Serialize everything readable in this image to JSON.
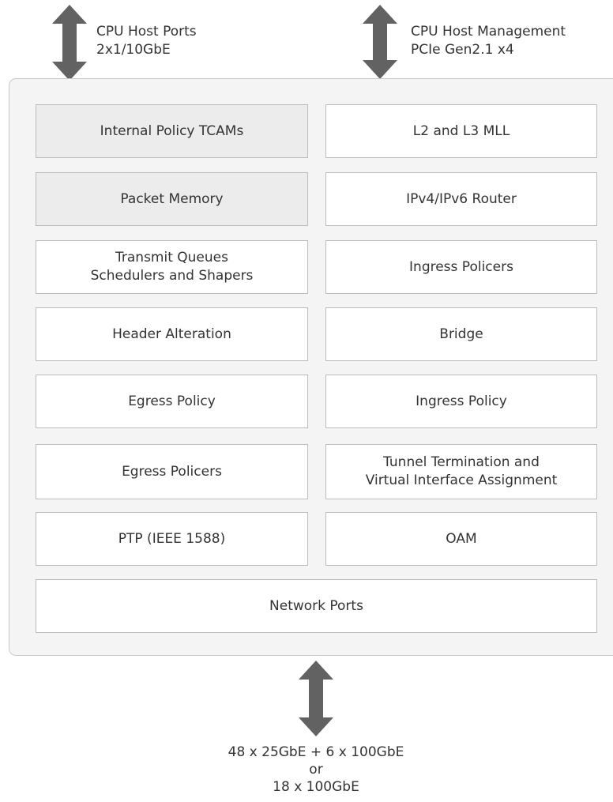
{
  "colors": {
    "arrow": "#626262",
    "chip_bg": "#f4f4f4",
    "chip_border": "#c9c9c9",
    "block_bg": "#ffffff",
    "block_shaded_bg": "#ececec",
    "block_border": "#bcbcbc",
    "text": "#333333"
  },
  "top": {
    "left_label": [
      "CPU Host Ports",
      "2x1/10GbE"
    ],
    "right_label": [
      "CPU Host Management",
      "PCIe Gen2.1 x4"
    ]
  },
  "left_column": [
    {
      "lines": [
        "Internal Policy TCAMs"
      ],
      "shaded": true
    },
    {
      "lines": [
        "Packet Memory"
      ],
      "shaded": true
    },
    {
      "lines": [
        "Transmit Queues",
        "Schedulers and Shapers"
      ],
      "shaded": false
    },
    {
      "lines": [
        "Header Alteration"
      ],
      "shaded": false
    },
    {
      "lines": [
        "Egress Policy"
      ],
      "shaded": false
    },
    {
      "lines": [
        "Egress Policers"
      ],
      "shaded": false
    },
    {
      "lines": [
        "PTP (IEEE 1588)"
      ],
      "shaded": false
    }
  ],
  "right_column": [
    {
      "lines": [
        "L2 and L3 MLL"
      ],
      "shaded": false
    },
    {
      "lines": [
        "IPv4/IPv6 Router"
      ],
      "shaded": false
    },
    {
      "lines": [
        "Ingress Policers"
      ],
      "shaded": false
    },
    {
      "lines": [
        "Bridge"
      ],
      "shaded": false
    },
    {
      "lines": [
        "Ingress Policy"
      ],
      "shaded": false
    },
    {
      "lines": [
        "Tunnel Termination and",
        "Virtual Interface Assignment"
      ],
      "shaded": false
    },
    {
      "lines": [
        "OAM"
      ],
      "shaded": false
    }
  ],
  "network_ports": {
    "label": "Network Ports"
  },
  "bottom_label": [
    "48 x 25GbE + 6 x 100GbE",
    "or",
    "18 x 100GbE"
  ]
}
